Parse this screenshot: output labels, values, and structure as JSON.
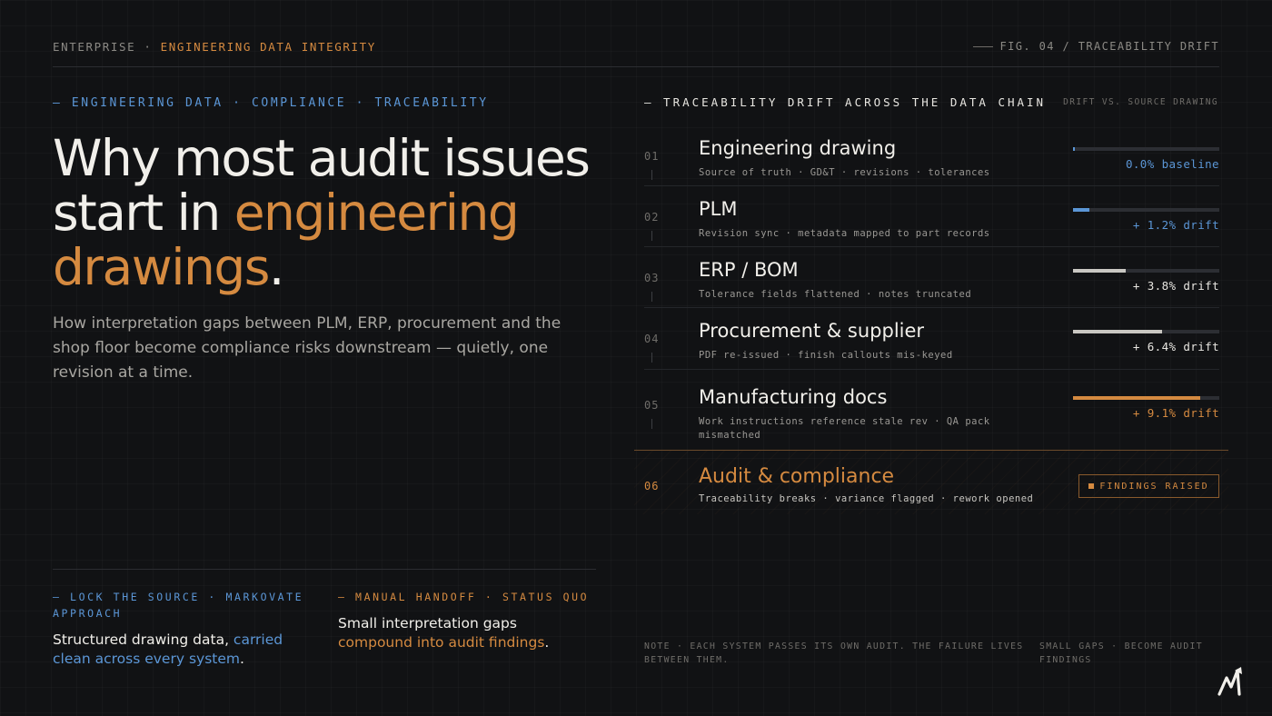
{
  "header": {
    "left_prefix": "ENTERPRISE · ",
    "left_accent": "ENGINEERING DATA INTEGRITY",
    "right": "FIG. 04 / TRACEABILITY DRIFT"
  },
  "hero": {
    "kicker": "— ENGINEERING DATA · COMPLIANCE · TRACEABILITY",
    "headline_part1": "Why most audit issues start in ",
    "headline_accent": "engineering drawings",
    "headline_end": ".",
    "lede": "How interpretation gaps between PLM, ERP, procurement and the shop floor become compliance risks downstream — quietly, one revision at a time."
  },
  "approach": {
    "kicker": "— LOCK THE SOURCE · MARKOVATE APPROACH",
    "body_plain": "Structured drawing data, ",
    "body_accent": "carried clean across every system",
    "body_end": "."
  },
  "status_quo": {
    "kicker": "— MANUAL HANDOFF · STATUS QUO",
    "body_plain": "Small interpretation gaps ",
    "body_accent": "compound into audit findings",
    "body_end": "."
  },
  "chain": {
    "title": "— TRACEABILITY DRIFT ACROSS THE DATA CHAIN",
    "subtitle": "DRIFT VS. SOURCE DRAWING",
    "rows": [
      {
        "num": "01",
        "name": "Engineering drawing",
        "detail": "Source of truth · GD&T · revisions · tolerances",
        "drift_pct": 0.0,
        "drift_label": "0.0% baseline",
        "color": "#5b96d6"
      },
      {
        "num": "02",
        "name": "PLM",
        "detail": "Revision sync · metadata mapped to part records",
        "drift_pct": 1.2,
        "drift_label": "+ 1.2% drift",
        "color": "#5b96d6"
      },
      {
        "num": "03",
        "name": "ERP / BOM",
        "detail": "Tolerance fields flattened · notes truncated",
        "drift_pct": 3.8,
        "drift_label": "+ 3.8% drift",
        "color": "#c9c7c2"
      },
      {
        "num": "04",
        "name": "Procurement & supplier",
        "detail": "PDF re-issued · finish callouts mis-keyed",
        "drift_pct": 6.4,
        "drift_label": "+ 6.4% drift",
        "color": "#c9c7c2"
      },
      {
        "num": "05",
        "name": "Manufacturing docs",
        "detail": "Work instructions reference stale rev · QA pack mismatched",
        "drift_pct": 9.1,
        "drift_label": "+ 9.1% drift",
        "color": "#d58a40"
      }
    ],
    "final": {
      "num": "06",
      "name": "Audit & compliance",
      "detail": "Traceability breaks · variance flagged · rework opened",
      "badge": "FINDINGS RAISED"
    }
  },
  "notes": {
    "left": "NOTE · EACH SYSTEM PASSES ITS OWN AUDIT. THE FAILURE LIVES BETWEEN THEM.",
    "right": "SMALL GAPS · BECOME AUDIT FINDINGS"
  },
  "colors": {
    "accent_orange": "#d58a40",
    "accent_blue": "#5b96d6",
    "background": "#111214"
  }
}
